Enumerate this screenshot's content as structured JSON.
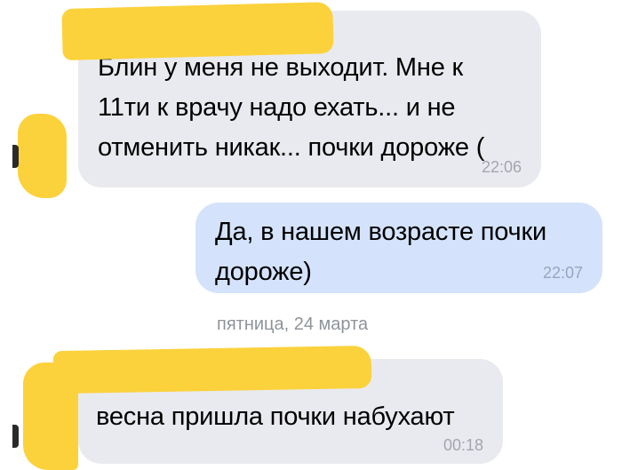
{
  "messages": [
    {
      "direction": "incoming",
      "text": "Блин у меня не выходит. Мне к\n11ти к врачу надо ехать... и не\nотменить никак... почки дороже (",
      "time": "22:06"
    },
    {
      "direction": "outgoing",
      "text": "Да, в нашем возрасте почки\nдороже)",
      "time": "22:07"
    },
    {
      "direction": "incoming",
      "text": "весна пришла почки набухают",
      "time": "00:18"
    }
  ],
  "date_separator": "пятница, 24 марта",
  "colors": {
    "incoming_bubble": "#e9eaef",
    "outgoing_bubble": "#d4e3fb",
    "redaction_marker": "#fbd23c",
    "timestamp": "#a3a7ad",
    "date_separator": "#8f949a"
  }
}
